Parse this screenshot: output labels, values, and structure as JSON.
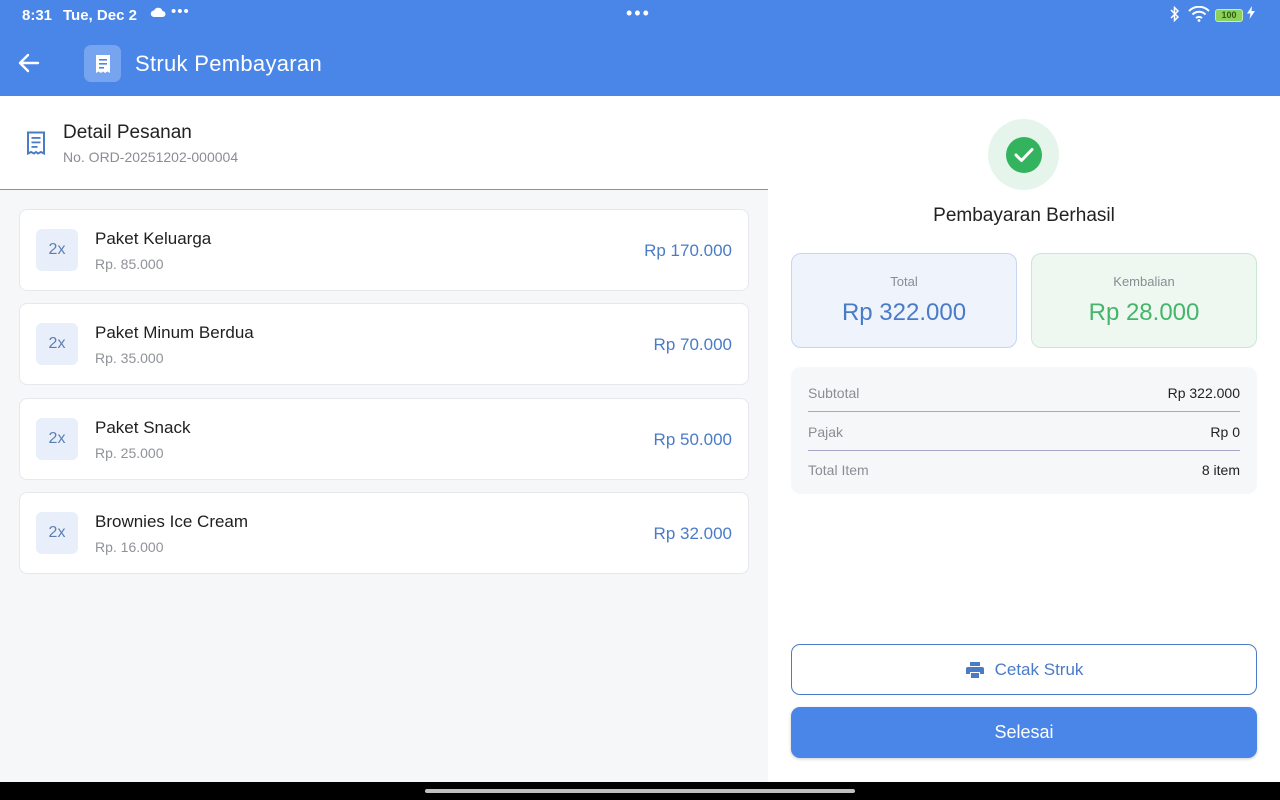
{
  "status_bar": {
    "time": "8:31",
    "date": "Tue, Dec 2",
    "battery": "100",
    "more_dots": "•••"
  },
  "app_bar": {
    "title": "Struk Pembayaran",
    "back_icon": "arrow-left-icon",
    "app_icon": "receipt-icon",
    "background": "#4a86e8"
  },
  "order": {
    "title": "Detail Pesanan",
    "number": "No. ORD-20251202-000004",
    "items": [
      {
        "qty": "2x",
        "name": "Paket Keluarga",
        "unit_price": "Rp. 85.000",
        "total": "Rp 170.000"
      },
      {
        "qty": "2x",
        "name": "Paket Minum Berdua",
        "unit_price": "Rp. 35.000",
        "total": "Rp 70.000"
      },
      {
        "qty": "2x",
        "name": "Paket Snack",
        "unit_price": "Rp. 25.000",
        "total": "Rp 50.000"
      },
      {
        "qty": "2x",
        "name": "Brownies Ice Cream",
        "unit_price": "Rp. 16.000",
        "total": "Rp 32.000"
      }
    ]
  },
  "payment": {
    "status": "Pembayaran Berhasil",
    "status_icon": "check-circle-icon",
    "total_label": "Total",
    "total_value": "Rp 322.000",
    "change_label": "Kembalian",
    "change_value": "Rp 28.000",
    "details": {
      "subtotal_label": "Subtotal",
      "subtotal_value": "Rp 322.000",
      "tax_label": "Pajak",
      "tax_value": "Rp 0",
      "items_label": "Total Item",
      "items_value": "8 item"
    },
    "print_label": "Cetak Struk",
    "print_icon": "printer-icon",
    "done_label": "Selesai"
  },
  "colors": {
    "accent": "#4a86e8",
    "success": "#34b35f",
    "price_text": "#4a7bc7",
    "change_text": "#46b56c"
  }
}
